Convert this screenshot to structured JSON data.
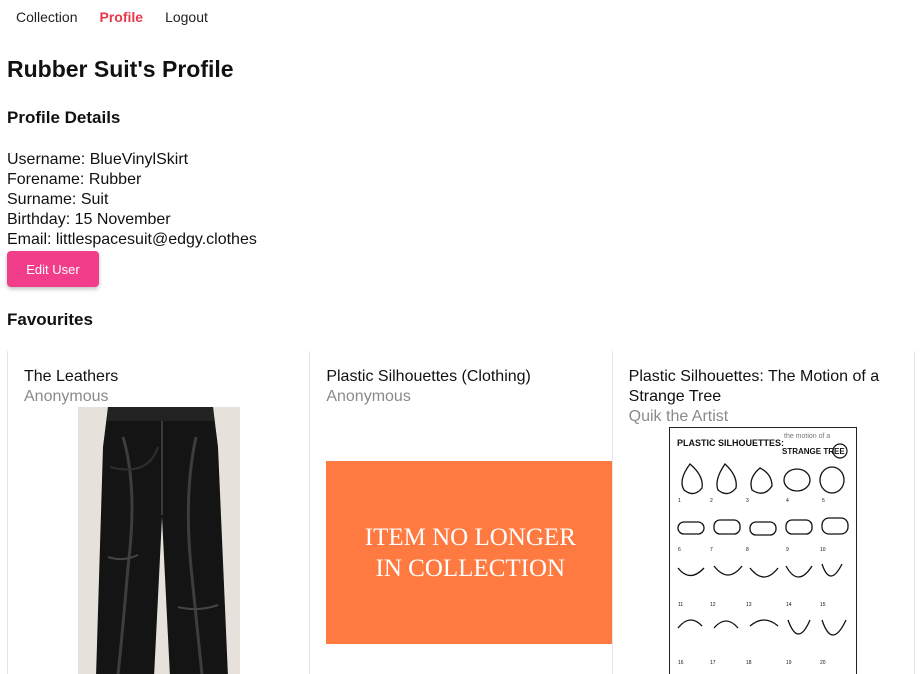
{
  "nav": {
    "items": [
      {
        "label": "Collection",
        "active": false
      },
      {
        "label": "Profile",
        "active": true
      },
      {
        "label": "Logout",
        "active": false
      }
    ],
    "active_color": "#e8394a"
  },
  "page_title": "Rubber Suit's Profile",
  "profile_details": {
    "heading": "Profile Details",
    "username": "Username: BlueVinylSkirt",
    "forename": "Forename: Rubber",
    "surname": "Surname: Suit",
    "birthday": "Birthday: 15 November",
    "email": "Email: littlespacesuit@edgy.clothes"
  },
  "edit_button": {
    "label": "Edit User",
    "color": "#f23d8a"
  },
  "favourites": {
    "heading": "Favourites",
    "items": [
      {
        "title": "The Leathers",
        "artist": "Anonymous",
        "image": "black-leather-trousers"
      },
      {
        "title": "Plastic Silhouettes (Clothing)",
        "artist": "Anonymous",
        "image": "item-no-longer-in-collection",
        "placeholder_text": "ITEM NO LONGER IN COLLECTION",
        "placeholder_color": "#ff7a40"
      },
      {
        "title": "Plastic Silhouettes: The Motion of a Strange Tree",
        "artist": "Quik the Artist",
        "image": "plastic-silhouettes-poster",
        "poster_title": "PLASTIC SILHOUETTES:",
        "poster_subtitle_1": "the motion of a",
        "poster_subtitle_2": "STRANGE TREE"
      }
    ]
  }
}
